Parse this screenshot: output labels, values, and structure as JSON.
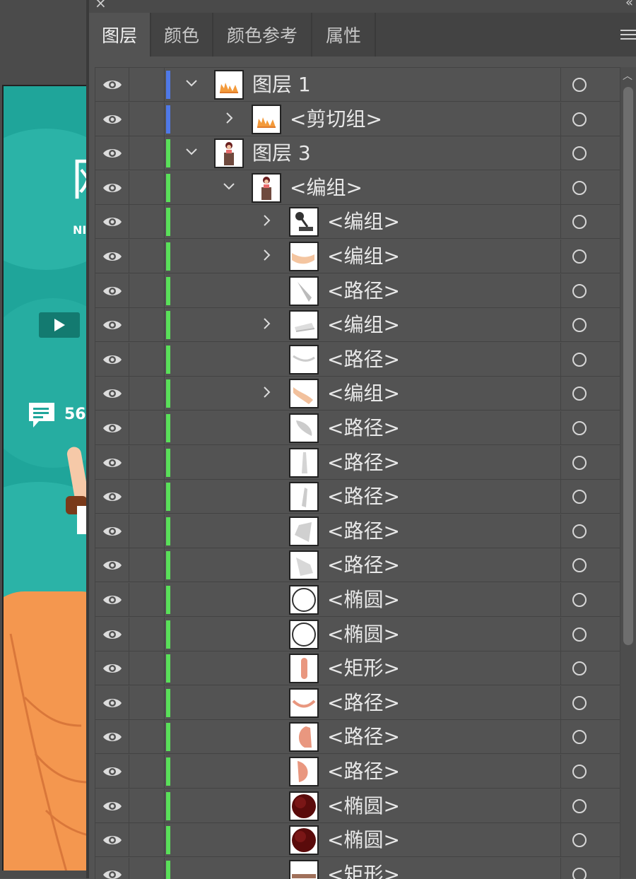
{
  "panel": {
    "tabs": [
      {
        "label": "图层",
        "active": true
      },
      {
        "label": "颜色",
        "active": false
      },
      {
        "label": "颜色参考",
        "active": false
      },
      {
        "label": "属性",
        "active": false
      }
    ]
  },
  "canvas": {
    "artboard_text": {
      "big_glyph": "网",
      "small_text": "NI",
      "comment_count": "56"
    },
    "colors": {
      "teal": "#1fa59a",
      "orange": "#f4974f"
    }
  },
  "layers": [
    {
      "name": "图层 1",
      "depth": 0,
      "expanded": true,
      "color": "#4f79e8",
      "thumb": "flame"
    },
    {
      "name": "<剪切组>",
      "depth": 1,
      "expanded": false,
      "color": "#4f79e8",
      "thumb": "flame"
    },
    {
      "name": "图层 3",
      "depth": 0,
      "expanded": true,
      "color": "#5ae05a",
      "thumb": "person"
    },
    {
      "name": "<编组>",
      "depth": 1,
      "expanded": true,
      "color": "#5ae05a",
      "thumb": "person"
    },
    {
      "name": "<编组>",
      "depth": 2,
      "expanded": false,
      "color": "#5ae05a",
      "thumb": "mic"
    },
    {
      "name": "<编组>",
      "depth": 2,
      "expanded": false,
      "color": "#5ae05a",
      "thumb": "arm"
    },
    {
      "name": "<路径>",
      "depth": 2,
      "expanded": null,
      "color": "#5ae05a",
      "thumb": "shard"
    },
    {
      "name": "<编组>",
      "depth": 2,
      "expanded": false,
      "color": "#5ae05a",
      "thumb": "book"
    },
    {
      "name": "<路径>",
      "depth": 2,
      "expanded": null,
      "color": "#5ae05a",
      "thumb": "curve"
    },
    {
      "name": "<编组>",
      "depth": 2,
      "expanded": false,
      "color": "#5ae05a",
      "thumb": "hand"
    },
    {
      "name": "<路径>",
      "depth": 2,
      "expanded": null,
      "color": "#5ae05a",
      "thumb": "leaf"
    },
    {
      "name": "<路径>",
      "depth": 2,
      "expanded": null,
      "color": "#5ae05a",
      "thumb": "thin"
    },
    {
      "name": "<路径>",
      "depth": 2,
      "expanded": null,
      "color": "#5ae05a",
      "thumb": "thin2"
    },
    {
      "name": "<路径>",
      "depth": 2,
      "expanded": null,
      "color": "#5ae05a",
      "thumb": "shard2"
    },
    {
      "name": "<路径>",
      "depth": 2,
      "expanded": null,
      "color": "#5ae05a",
      "thumb": "shard3"
    },
    {
      "name": "<椭圆>",
      "depth": 2,
      "expanded": null,
      "color": "#5ae05a",
      "thumb": "circle"
    },
    {
      "name": "<椭圆>",
      "depth": 2,
      "expanded": null,
      "color": "#5ae05a",
      "thumb": "circle"
    },
    {
      "name": "<矩形>",
      "depth": 2,
      "expanded": null,
      "color": "#5ae05a",
      "thumb": "pill"
    },
    {
      "name": "<路径>",
      "depth": 2,
      "expanded": null,
      "color": "#5ae05a",
      "thumb": "smile"
    },
    {
      "name": "<路径>",
      "depth": 2,
      "expanded": null,
      "color": "#5ae05a",
      "thumb": "cheek"
    },
    {
      "name": "<路径>",
      "depth": 2,
      "expanded": null,
      "color": "#5ae05a",
      "thumb": "cheek2"
    },
    {
      "name": "<椭圆>",
      "depth": 2,
      "expanded": null,
      "color": "#5ae05a",
      "thumb": "dark"
    },
    {
      "name": "<椭圆>",
      "depth": 2,
      "expanded": null,
      "color": "#5ae05a",
      "thumb": "dark"
    },
    {
      "name": "<矩形>",
      "depth": 2,
      "expanded": null,
      "color": "#5ae05a",
      "thumb": "bar"
    }
  ]
}
